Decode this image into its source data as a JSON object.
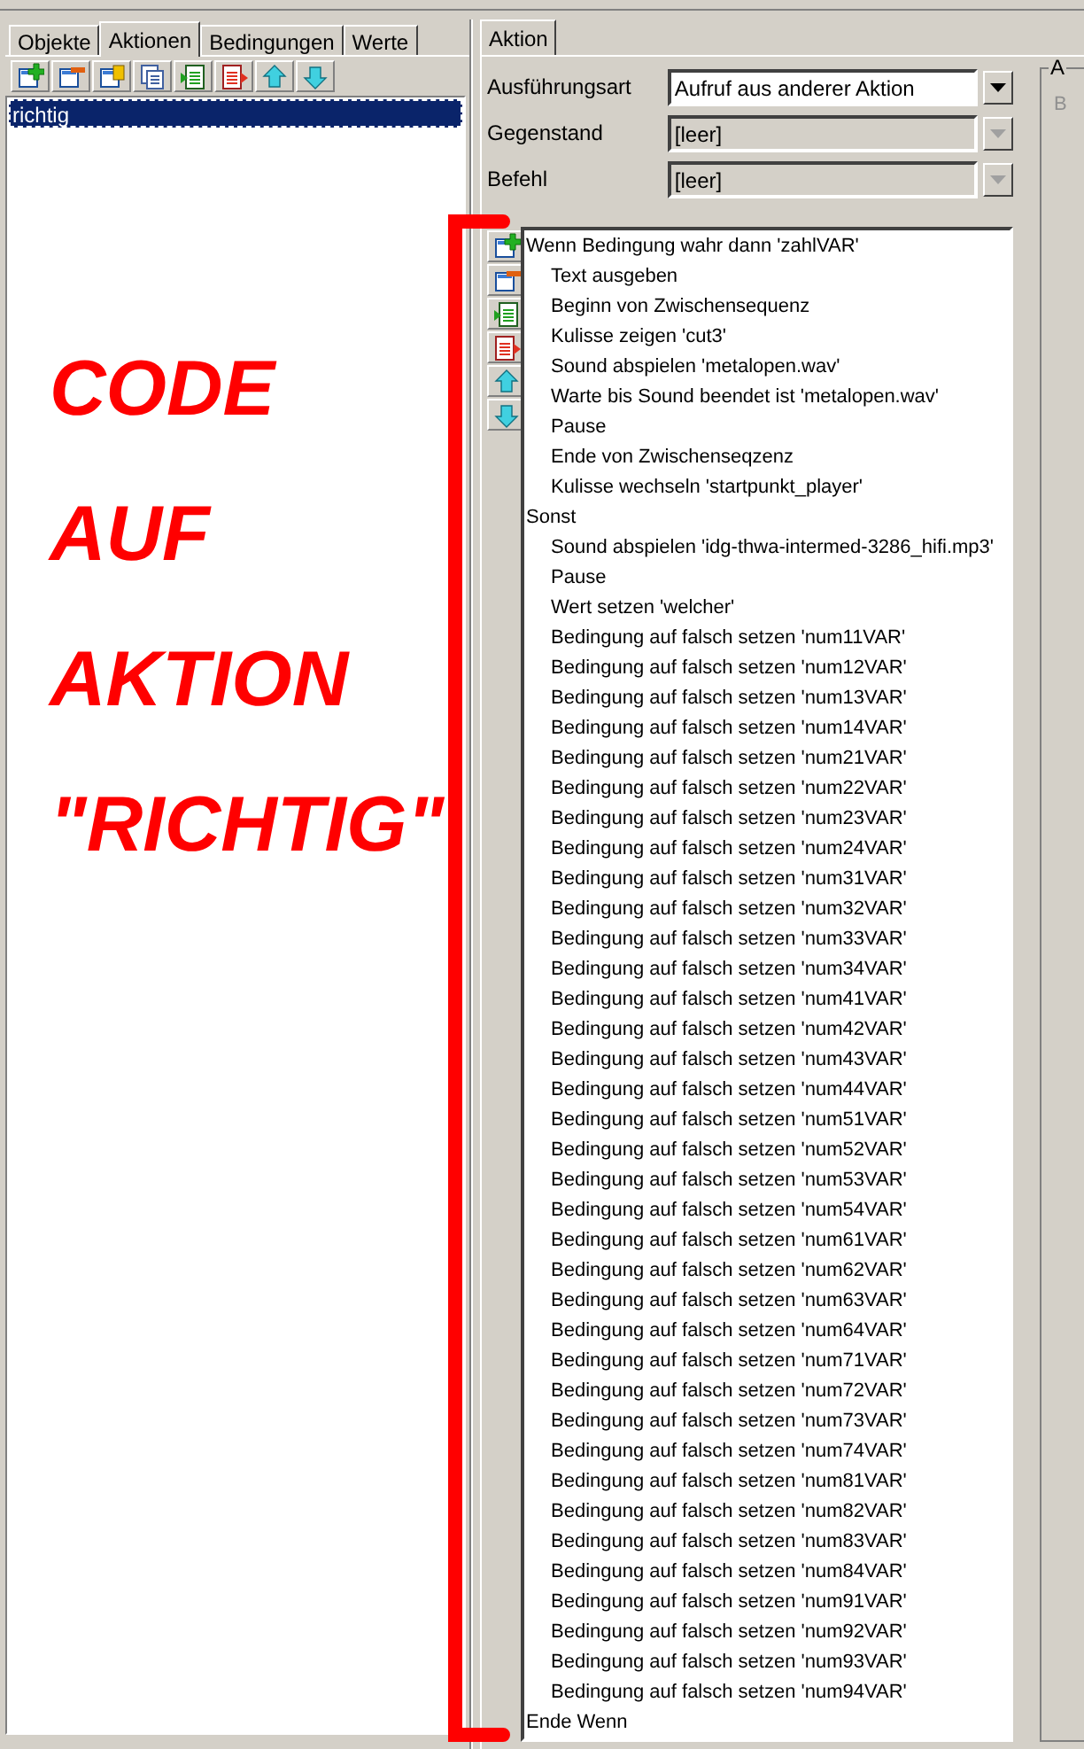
{
  "left_tabs": [
    {
      "label": "Objekte",
      "selected": false
    },
    {
      "label": "Aktionen",
      "selected": true
    },
    {
      "label": "Bedingungen",
      "selected": false
    },
    {
      "label": "Werte",
      "selected": false
    }
  ],
  "actions_list": [
    {
      "label": "richtig",
      "selected": true
    }
  ],
  "right_tab": {
    "label": "Aktion",
    "selected": true
  },
  "fields": [
    {
      "label": "Ausführungsart",
      "value": "Aufruf aus anderer Aktion",
      "disabled": false
    },
    {
      "label": "Gegenstand",
      "value": "[leer]",
      "disabled": true
    },
    {
      "label": "Befehl",
      "value": "[leer]",
      "disabled": true
    }
  ],
  "group": {
    "title": "A",
    "label": "B"
  },
  "code_lines": [
    {
      "text": "Wenn Bedingung wahr dann 'zahlVAR'",
      "children": [
        {
          "text": "Text ausgeben"
        },
        {
          "text": "Beginn von Zwischensequenz"
        },
        {
          "text": "Kulisse zeigen 'cut3'"
        },
        {
          "text": "Sound abspielen 'metalopen.wav'"
        },
        {
          "text": "Warte bis Sound beendet ist 'metalopen.wav'"
        },
        {
          "text": "Pause"
        },
        {
          "text": "Ende von Zwischenseqzenz"
        },
        {
          "text": "Kulisse wechseln 'startpunkt_player'"
        }
      ]
    },
    {
      "text": "Sonst",
      "children": [
        {
          "text": "Sound abspielen 'idg-thwa-intermed-3286_hifi.mp3'"
        },
        {
          "text": "Pause"
        },
        {
          "text": "Wert setzen 'welcher'"
        },
        {
          "text": "Bedingung auf falsch setzen 'num11VAR'"
        },
        {
          "text": "Bedingung auf falsch setzen 'num12VAR'"
        },
        {
          "text": "Bedingung auf falsch setzen 'num13VAR'"
        },
        {
          "text": "Bedingung auf falsch setzen 'num14VAR'"
        },
        {
          "text": "Bedingung auf falsch setzen 'num21VAR'"
        },
        {
          "text": "Bedingung auf falsch setzen 'num22VAR'"
        },
        {
          "text": "Bedingung auf falsch setzen 'num23VAR'"
        },
        {
          "text": "Bedingung auf falsch setzen 'num24VAR'"
        },
        {
          "text": "Bedingung auf falsch setzen 'num31VAR'"
        },
        {
          "text": "Bedingung auf falsch setzen 'num32VAR'"
        },
        {
          "text": "Bedingung auf falsch setzen 'num33VAR'"
        },
        {
          "text": "Bedingung auf falsch setzen 'num34VAR'"
        },
        {
          "text": "Bedingung auf falsch setzen 'num41VAR'"
        },
        {
          "text": "Bedingung auf falsch setzen 'num42VAR'"
        },
        {
          "text": "Bedingung auf falsch setzen 'num43VAR'"
        },
        {
          "text": "Bedingung auf falsch setzen 'num44VAR'"
        },
        {
          "text": "Bedingung auf falsch setzen 'num51VAR'"
        },
        {
          "text": "Bedingung auf falsch setzen 'num52VAR'"
        },
        {
          "text": "Bedingung auf falsch setzen 'num53VAR'"
        },
        {
          "text": "Bedingung auf falsch setzen 'num54VAR'"
        },
        {
          "text": "Bedingung auf falsch setzen 'num61VAR'"
        },
        {
          "text": "Bedingung auf falsch setzen 'num62VAR'"
        },
        {
          "text": "Bedingung auf falsch setzen 'num63VAR'"
        },
        {
          "text": "Bedingung auf falsch setzen 'num64VAR'"
        },
        {
          "text": "Bedingung auf falsch setzen 'num71VAR'"
        },
        {
          "text": "Bedingung auf falsch setzen 'num72VAR'"
        },
        {
          "text": "Bedingung auf falsch setzen 'num73VAR'"
        },
        {
          "text": "Bedingung auf falsch setzen 'num74VAR'"
        },
        {
          "text": "Bedingung auf falsch setzen 'num81VAR'"
        },
        {
          "text": "Bedingung auf falsch setzen 'num82VAR'"
        },
        {
          "text": "Bedingung auf falsch setzen 'num83VAR'"
        },
        {
          "text": "Bedingung auf falsch setzen 'num84VAR'"
        },
        {
          "text": "Bedingung auf falsch setzen 'num91VAR'"
        },
        {
          "text": "Bedingung auf falsch setzen 'num92VAR'"
        },
        {
          "text": "Bedingung auf falsch setzen 'num93VAR'"
        },
        {
          "text": "Bedingung auf falsch setzen 'num94VAR'"
        }
      ]
    },
    {
      "text": "Ende Wenn"
    }
  ],
  "annotation": [
    "CODE",
    "AUF",
    "AKTION",
    "\"RICHTIG\""
  ]
}
